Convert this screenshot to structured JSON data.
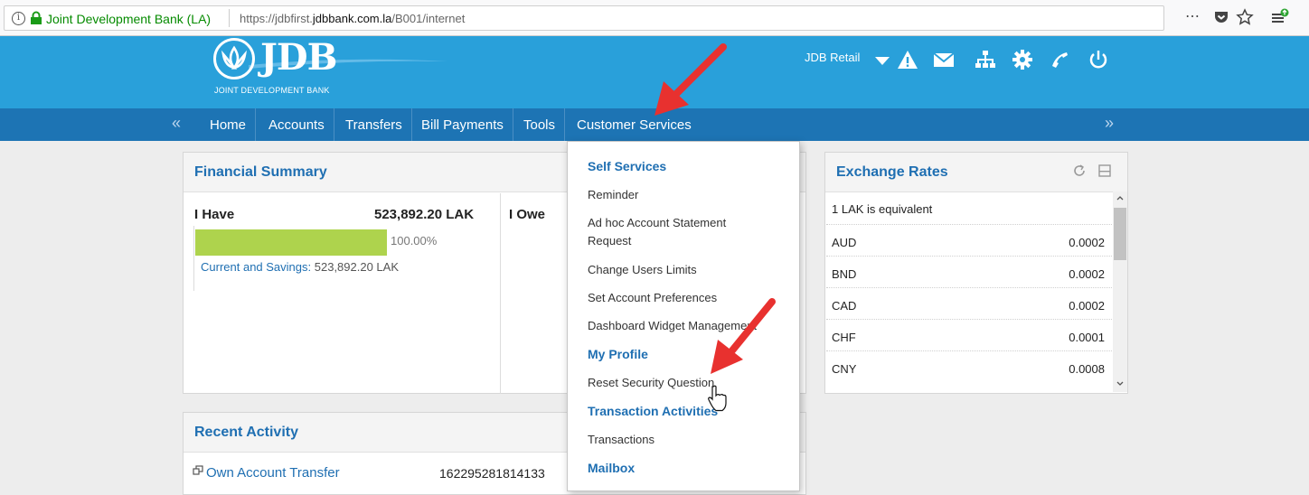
{
  "browser": {
    "site_identity": "Joint Development Bank (LA)",
    "url_prefix": "https://jdbfirst.",
    "url_domain": "jdbbank.com.la",
    "url_path": "/B001/internet",
    "menu_dots": "⋯"
  },
  "header": {
    "logo_text": "JDB",
    "logo_subtitle": "JOINT DEVELOPMENT BANK",
    "retail_label": "JDB Retail",
    "icons": [
      "caret-down-icon",
      "warning-icon",
      "mail-icon",
      "sitemap-icon",
      "gear-icon",
      "phone-icon",
      "power-icon"
    ]
  },
  "nav": {
    "left_arrow": "«",
    "right_arrow": "»",
    "items": [
      "Home",
      "Accounts",
      "Transfers",
      "Bill Payments",
      "Tools",
      "Customer Services"
    ]
  },
  "financial_summary": {
    "title": "Financial Summary",
    "have_label": "I Have",
    "have_amount": "523,892.20 LAK",
    "have_percent": "100.00%",
    "have_fill": 1.0,
    "owe_label": "I Owe",
    "cs_link_label": "Current and Savings:",
    "cs_amount": "523,892.20 LAK"
  },
  "recent_activity": {
    "title": "Recent Activity",
    "item_label": "Own Account Transfer",
    "item_ref": "162295281814133"
  },
  "exchange_rates": {
    "title": "Exchange Rates",
    "base_label": "1  LAK is equivalent",
    "rows": [
      {
        "currency": "AUD",
        "value": "0.0002"
      },
      {
        "currency": "BND",
        "value": "0.0002"
      },
      {
        "currency": "CAD",
        "value": "0.0002"
      },
      {
        "currency": "CHF",
        "value": "0.0001"
      },
      {
        "currency": "CNY",
        "value": "0.0008"
      }
    ]
  },
  "dropdown": {
    "self_services": "Self Services",
    "reminder": "Reminder",
    "adhoc": "Ad hoc Account Statement Request",
    "change_limits": "Change Users Limits",
    "set_prefs": "Set Account Preferences",
    "dashboard": "Dashboard Widget Management",
    "my_profile": "My Profile",
    "reset_security": "Reset Security Question",
    "transaction_activities": "Transaction Activities",
    "transactions": "Transactions",
    "mailbox": "Mailbox"
  },
  "colors": {
    "header_blue": "#29a0da",
    "nav_blue": "#1d74b4",
    "link_blue": "#1f6fb2",
    "bar_green": "#aed34d",
    "arrow_red": "#e8312f"
  }
}
